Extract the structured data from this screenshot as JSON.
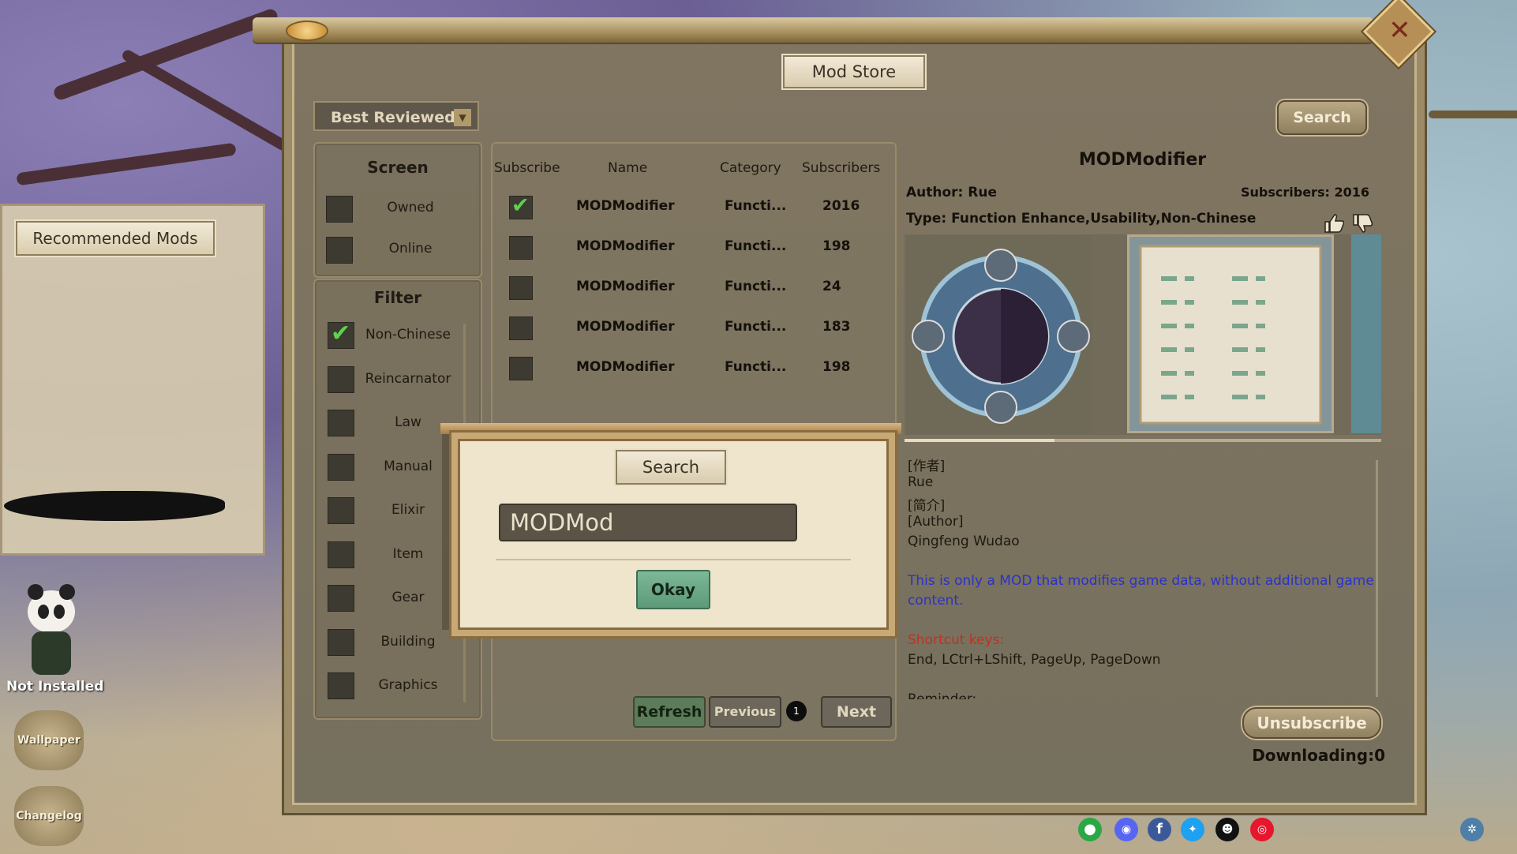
{
  "window": {
    "title": "Mod Store"
  },
  "toolbar": {
    "sort_selected": "Best Reviewed",
    "search_label": "Search"
  },
  "screen_panel": {
    "title": "Screen",
    "items": [
      {
        "label": "Owned",
        "checked": false
      },
      {
        "label": "Online",
        "checked": false
      }
    ]
  },
  "filter_panel": {
    "title": "Filter",
    "items": [
      {
        "label": "Non-Chinese",
        "checked": true
      },
      {
        "label": "Reincarnator",
        "checked": false
      },
      {
        "label": "Law",
        "checked": false
      },
      {
        "label": "Manual",
        "checked": false
      },
      {
        "label": "Elixir",
        "checked": false
      },
      {
        "label": "Item",
        "checked": false
      },
      {
        "label": "Gear",
        "checked": false
      },
      {
        "label": "Building",
        "checked": false
      },
      {
        "label": "Graphics",
        "checked": false
      }
    ]
  },
  "mod_list": {
    "headers": {
      "subscribe": "Subscribe",
      "name": "Name",
      "category": "Category",
      "subscribers": "Subscribers"
    },
    "rows": [
      {
        "subscribed": true,
        "name": "MODModifier",
        "category": "Functi...",
        "subscribers": "2016"
      },
      {
        "subscribed": false,
        "name": "MODModifier",
        "category": "Functi...",
        "subscribers": "198"
      },
      {
        "subscribed": false,
        "name": "MODModifier",
        "category": "Functi...",
        "subscribers": "24"
      },
      {
        "subscribed": false,
        "name": "MODModifier",
        "category": "Functi...",
        "subscribers": "183"
      },
      {
        "subscribed": false,
        "name": "MODModifier",
        "category": "Functi...",
        "subscribers": "198"
      }
    ],
    "pagination": {
      "refresh_label": "Refresh",
      "previous_label": "Previous",
      "page": "1",
      "next_label": "Next"
    }
  },
  "detail": {
    "title": "MODModifier",
    "author": "Author: Rue",
    "subscribers": "Subscribers: 2016",
    "type": "Type:  Function Enhance,Usability,Non-Chinese",
    "description": [
      {
        "text": "[作者]",
        "style": "normal"
      },
      {
        "text": "    Rue",
        "style": "normal"
      },
      {
        "text": "[简介]",
        "style": "normal"
      },
      {
        "text": "[Author]",
        "style": "normal"
      },
      {
        "text": " Qingfeng Wudao",
        "style": "normal"
      },
      {
        "text": "This is only a MOD that modifies game data, without additional game",
        "style": "blue"
      },
      {
        "text": "content.",
        "style": "blue"
      },
      {
        "text": "Shortcut keys:",
        "style": "red"
      },
      {
        "text": " End, LCtrl+LShift, PageUp, PageDown",
        "style": "normal"
      },
      {
        "text": "Reminder:",
        "style": "normal"
      }
    ],
    "unsubscribe_label": "Unsubscribe",
    "downloading": "Downloading:0"
  },
  "left_side": {
    "recommended_title": "Recommended Mods",
    "status": "Not Installed",
    "wallpaper_label": "Wallpaper",
    "changelog_label": "Changelog"
  },
  "modal": {
    "title": "Search",
    "input_value": "MODMod",
    "okay_label": "Okay"
  },
  "colors": {
    "accent_green": "#5fd14f",
    "panel": "#807561",
    "blue_text": "#2b32c9",
    "red_text": "#c0321f"
  }
}
